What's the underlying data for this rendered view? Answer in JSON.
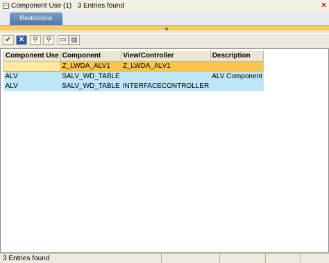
{
  "window": {
    "title": "Component Use (1)",
    "entries_found": "3 Entries found"
  },
  "tabs": [
    {
      "label": "Restrictions",
      "active": true
    }
  ],
  "toolbar": {
    "buttons": [
      {
        "icon": "checkmark-icon"
      },
      {
        "icon": "cancel-icon"
      },
      {
        "icon": "find-icon"
      },
      {
        "icon": "find-next-icon"
      },
      {
        "icon": "print-icon"
      },
      {
        "icon": "list-icon"
      }
    ]
  },
  "table": {
    "columns": [
      "Component Use",
      "Component",
      "View/Controller",
      "Description"
    ],
    "rows": [
      [
        "",
        "Z_LWDA_ALV1",
        "Z_LWDA_ALV1",
        ""
      ],
      [
        "ALV",
        "SALV_WD_TABLE",
        "",
        "ALV Component"
      ],
      [
        "ALV",
        "SALV_WD_TABLE",
        "INTERFACECONTROLLER",
        ""
      ]
    ],
    "selected_row": 0
  },
  "status": {
    "text": "3 Entries found"
  },
  "colors": {
    "selected_row": "#fbc44b",
    "alt_row": "#bde6f6",
    "tab_active": "#4e7aa9",
    "header_bg": "#eae6d4"
  }
}
